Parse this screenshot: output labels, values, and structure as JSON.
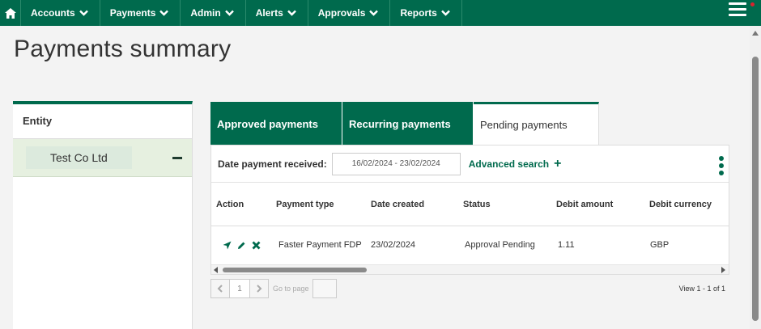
{
  "nav": {
    "items": [
      {
        "label": "Accounts"
      },
      {
        "label": "Payments"
      },
      {
        "label": "Admin"
      },
      {
        "label": "Alerts"
      },
      {
        "label": "Approvals"
      },
      {
        "label": "Reports"
      }
    ]
  },
  "page": {
    "title": "Payments summary"
  },
  "entity": {
    "header": "Entity",
    "name": "Test Co Ltd"
  },
  "tabs": [
    {
      "label": "Approved payments"
    },
    {
      "label": "Recurring payments"
    },
    {
      "label": "Pending payments"
    }
  ],
  "filter": {
    "label": "Date payment received:",
    "date_range": "16/02/2024 - 23/02/2024",
    "advanced_search": "Advanced search"
  },
  "table": {
    "headers": [
      "Action",
      "Payment type",
      "Date created",
      "Status",
      "Debit amount",
      "Debit currency"
    ],
    "rows": [
      {
        "payment_type": "Faster Payment FDP",
        "date_created": "23/02/2024",
        "status": "Approval Pending",
        "debit_amount": "1.11",
        "debit_currency": "GBP"
      }
    ]
  },
  "pager": {
    "page": "1",
    "goto_label": "Go to page",
    "view_count": "View 1 - 1 of 1"
  },
  "colors": {
    "brand_green": "#006a4d",
    "entity_bg": "#e6f0e0"
  }
}
